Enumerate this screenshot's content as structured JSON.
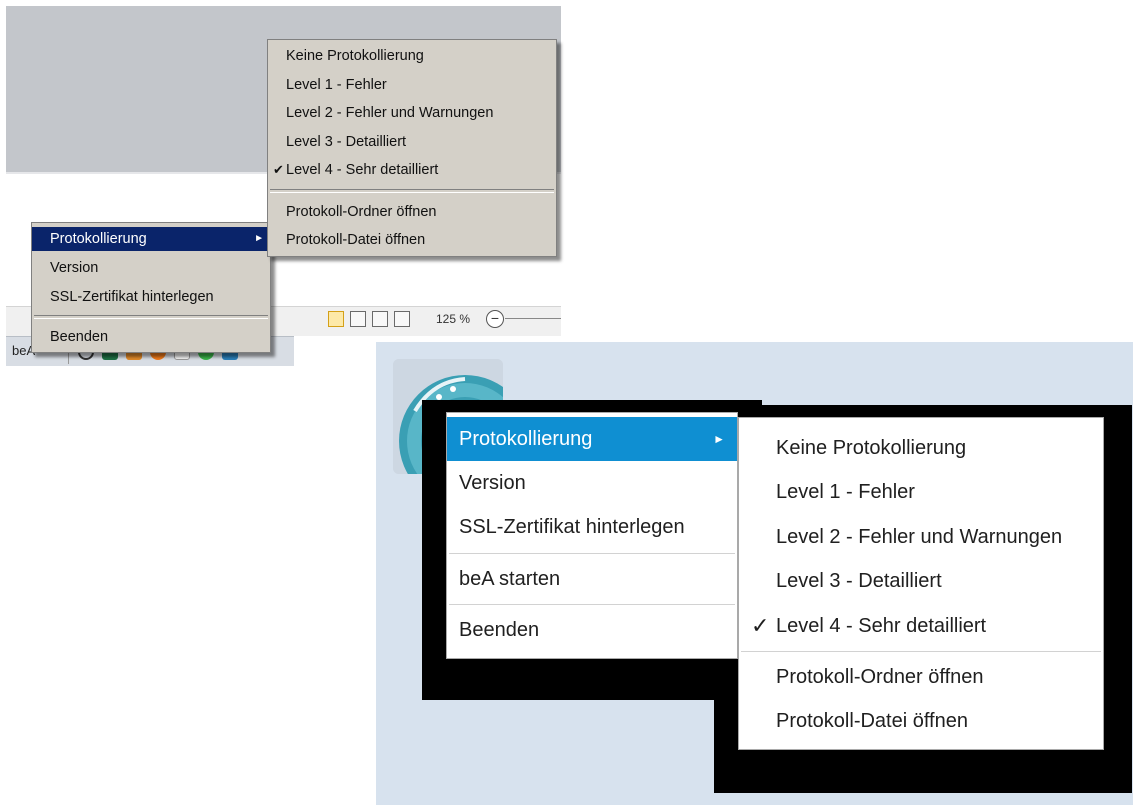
{
  "screen_a": {
    "zoom_text": "125 %",
    "zoom_minus": "−",
    "taskbar_label": "beA",
    "main_menu": [
      {
        "label": "Protokollierung",
        "submenu_arrow": "►"
      },
      {
        "label": "Version"
      },
      {
        "label": "SSL-Zertifikat hinterlegen"
      },
      {
        "label": "Beenden"
      }
    ],
    "sub_menu": [
      {
        "label": "Keine Protokollierung"
      },
      {
        "label": "Level 1 - Fehler"
      },
      {
        "label": "Level 2 - Fehler und Warnungen"
      },
      {
        "label": "Level 3 - Detailliert"
      },
      {
        "label": "Level 4 - Sehr detailliert",
        "checked": true
      },
      {
        "label": "Protokoll-Ordner öffnen"
      },
      {
        "label": "Protokoll-Datei öffnen"
      }
    ],
    "check_mark": "✔"
  },
  "screen_b": {
    "main_menu": [
      {
        "label": "Protokollierung",
        "submenu_arrow": "►"
      },
      {
        "label": "Version"
      },
      {
        "label": "SSL-Zertifikat hinterlegen"
      },
      {
        "label": "beA starten"
      },
      {
        "label": "Beenden"
      }
    ],
    "sub_menu": [
      {
        "label": "Keine Protokollierung"
      },
      {
        "label": "Level 1 - Fehler"
      },
      {
        "label": "Level 2 - Fehler und Warnungen"
      },
      {
        "label": "Level 3 - Detailliert"
      },
      {
        "label": "Level 4 - Sehr detailliert",
        "checked": true
      },
      {
        "label": "Protokoll-Ordner öffnen"
      },
      {
        "label": "Protokoll-Datei öffnen"
      }
    ],
    "check_mark": "✓"
  },
  "colors": {
    "classic_highlight": "#0a246a",
    "classic_menu_bg": "#d4d0c8",
    "modern_highlight": "#0f8fd2",
    "modern_bg": "#d7e2ee"
  }
}
